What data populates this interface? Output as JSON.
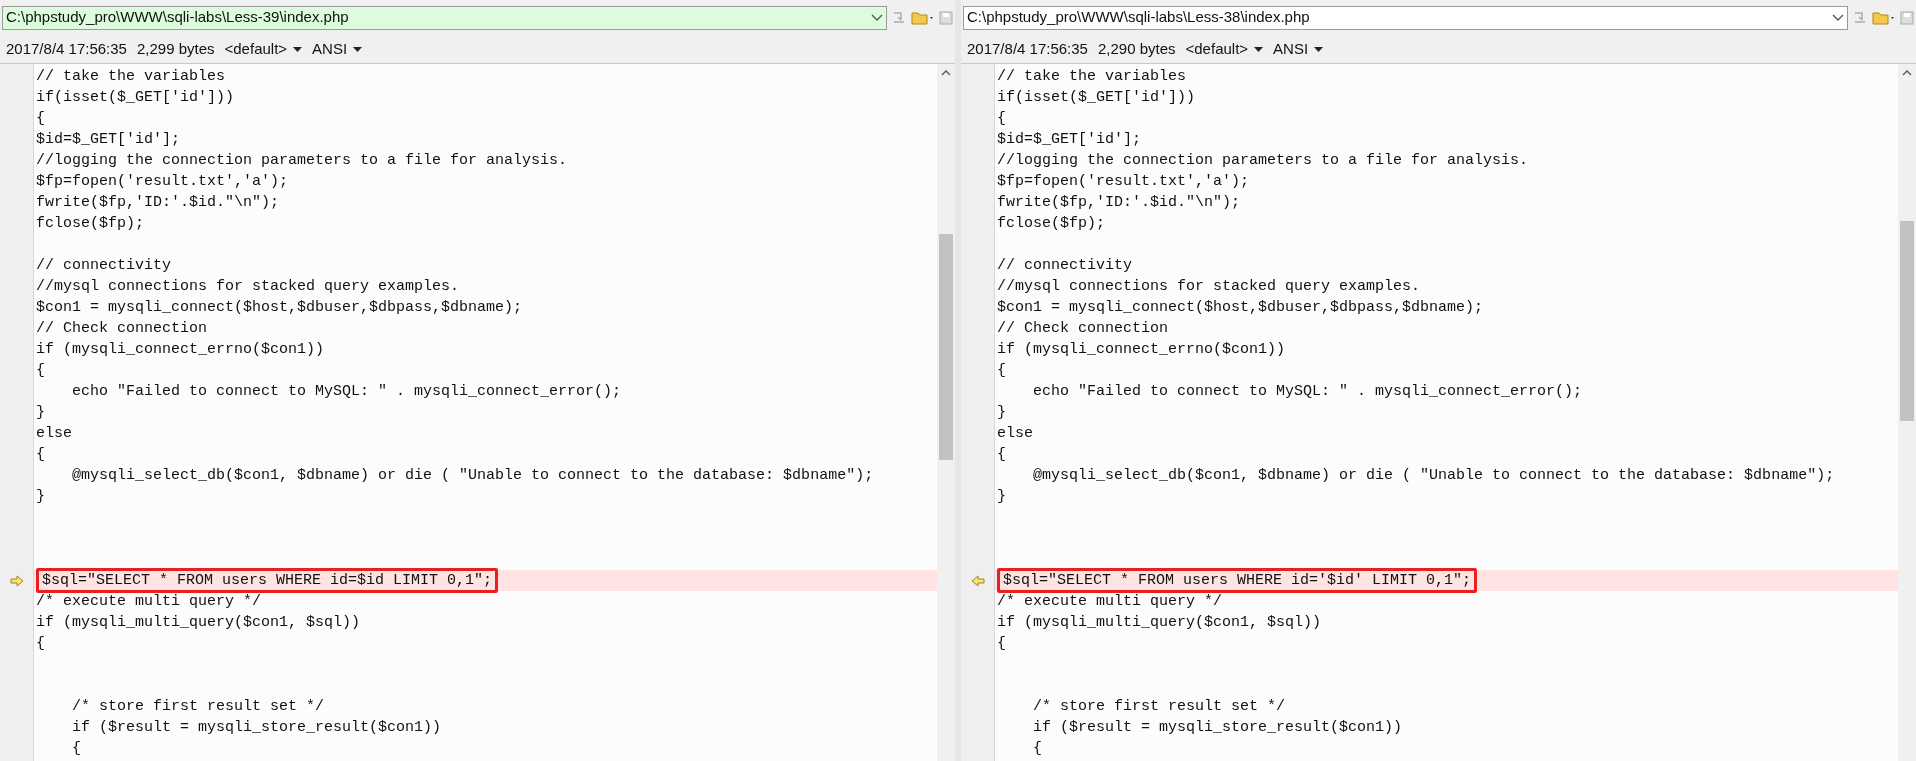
{
  "panes": [
    {
      "arrow_points_right": true,
      "path": "C:\\phpstudy_pro\\WWW\\sqli-labs\\Less-39\\index.php",
      "path_highlighted": true,
      "date": "2017/8/4 17:56:35",
      "size": "2,299 bytes",
      "profile": "<default>",
      "encoding": "ANSI",
      "lines": [
        {
          "kind": "same",
          "text": "// take the variables"
        },
        {
          "kind": "same",
          "text": "if(isset($_GET['id']))"
        },
        {
          "kind": "same",
          "text": "{"
        },
        {
          "kind": "same",
          "text": "$id=$_GET['id'];"
        },
        {
          "kind": "same",
          "text": "//logging the connection parameters to a file for analysis."
        },
        {
          "kind": "same",
          "text": "$fp=fopen('result.txt','a');"
        },
        {
          "kind": "same",
          "text": "fwrite($fp,'ID:'.$id.\"\\n\");"
        },
        {
          "kind": "same",
          "text": "fclose($fp);"
        },
        {
          "kind": "blank"
        },
        {
          "kind": "same",
          "text": "// connectivity"
        },
        {
          "kind": "same",
          "text": "//mysql connections for stacked query examples."
        },
        {
          "kind": "same",
          "text": "$con1 = mysqli_connect($host,$dbuser,$dbpass,$dbname);"
        },
        {
          "kind": "same",
          "text": "// Check connection"
        },
        {
          "kind": "same",
          "text": "if (mysqli_connect_errno($con1))"
        },
        {
          "kind": "same",
          "text": "{"
        },
        {
          "kind": "same",
          "text": "    echo \"Failed to connect to MySQL: \" . mysqli_connect_error();"
        },
        {
          "kind": "same",
          "text": "}"
        },
        {
          "kind": "same",
          "text": "else"
        },
        {
          "kind": "same",
          "text": "{"
        },
        {
          "kind": "same",
          "text": "    @mysqli_select_db($con1, $dbname) or die ( \"Unable to connect to the database: $dbname\");"
        },
        {
          "kind": "same",
          "text": "}"
        },
        {
          "kind": "blank"
        },
        {
          "kind": "blank"
        },
        {
          "kind": "blank"
        },
        {
          "kind": "changed",
          "text": "$sql=\"SELECT * FROM users WHERE id=$id LIMIT 0,1\";",
          "boxed": true
        },
        {
          "kind": "same",
          "text": "/* execute multi query */"
        },
        {
          "kind": "same",
          "text": "if (mysqli_multi_query($con1, $sql))"
        },
        {
          "kind": "same",
          "text": "{"
        },
        {
          "kind": "blank"
        },
        {
          "kind": "blank"
        },
        {
          "kind": "same",
          "text": "    /* store first result set */"
        },
        {
          "kind": "same",
          "text": "    if ($result = mysqli_store_result($con1))"
        },
        {
          "kind": "same",
          "text": "    {"
        }
      ]
    },
    {
      "arrow_points_right": false,
      "path": "C:\\phpstudy_pro\\WWW\\sqli-labs\\Less-38\\index.php",
      "path_highlighted": false,
      "date": "2017/8/4 17:56:35",
      "size": "2,290 bytes",
      "profile": "<default>",
      "encoding": "ANSI",
      "lines": [
        {
          "kind": "same",
          "text": "// take the variables"
        },
        {
          "kind": "same",
          "text": "if(isset($_GET['id']))"
        },
        {
          "kind": "same",
          "text": "{"
        },
        {
          "kind": "same",
          "text": "$id=$_GET['id'];"
        },
        {
          "kind": "same",
          "text": "//logging the connection parameters to a file for analysis."
        },
        {
          "kind": "same",
          "text": "$fp=fopen('result.txt','a');"
        },
        {
          "kind": "same",
          "text": "fwrite($fp,'ID:'.$id.\"\\n\");"
        },
        {
          "kind": "same",
          "text": "fclose($fp);"
        },
        {
          "kind": "blank"
        },
        {
          "kind": "same",
          "text": "// connectivity"
        },
        {
          "kind": "same",
          "text": "//mysql connections for stacked query examples."
        },
        {
          "kind": "same",
          "text": "$con1 = mysqli_connect($host,$dbuser,$dbpass,$dbname);"
        },
        {
          "kind": "same",
          "text": "// Check connection"
        },
        {
          "kind": "same",
          "text": "if (mysqli_connect_errno($con1))"
        },
        {
          "kind": "same",
          "text": "{"
        },
        {
          "kind": "same",
          "text": "    echo \"Failed to connect to MySQL: \" . mysqli_connect_error();"
        },
        {
          "kind": "same",
          "text": "}"
        },
        {
          "kind": "same",
          "text": "else"
        },
        {
          "kind": "same",
          "text": "{"
        },
        {
          "kind": "same",
          "text": "    @mysqli_select_db($con1, $dbname) or die ( \"Unable to connect to the database: $dbname\");"
        },
        {
          "kind": "same",
          "text": "}"
        },
        {
          "kind": "blank"
        },
        {
          "kind": "blank"
        },
        {
          "kind": "blank"
        },
        {
          "kind": "changed",
          "text": "$sql=\"SELECT * FROM users WHERE id='$id' LIMIT 0,1\";",
          "boxed": true
        },
        {
          "kind": "same",
          "text": "/* execute multi query */"
        },
        {
          "kind": "same",
          "text": "if (mysqli_multi_query($con1, $sql))"
        },
        {
          "kind": "same",
          "text": "{"
        },
        {
          "kind": "blank"
        },
        {
          "kind": "blank"
        },
        {
          "kind": "same",
          "text": "    /* store first result set */"
        },
        {
          "kind": "same",
          "text": "    if ($result = mysqli_store_result($con1))"
        },
        {
          "kind": "same",
          "text": "    {"
        }
      ]
    }
  ]
}
